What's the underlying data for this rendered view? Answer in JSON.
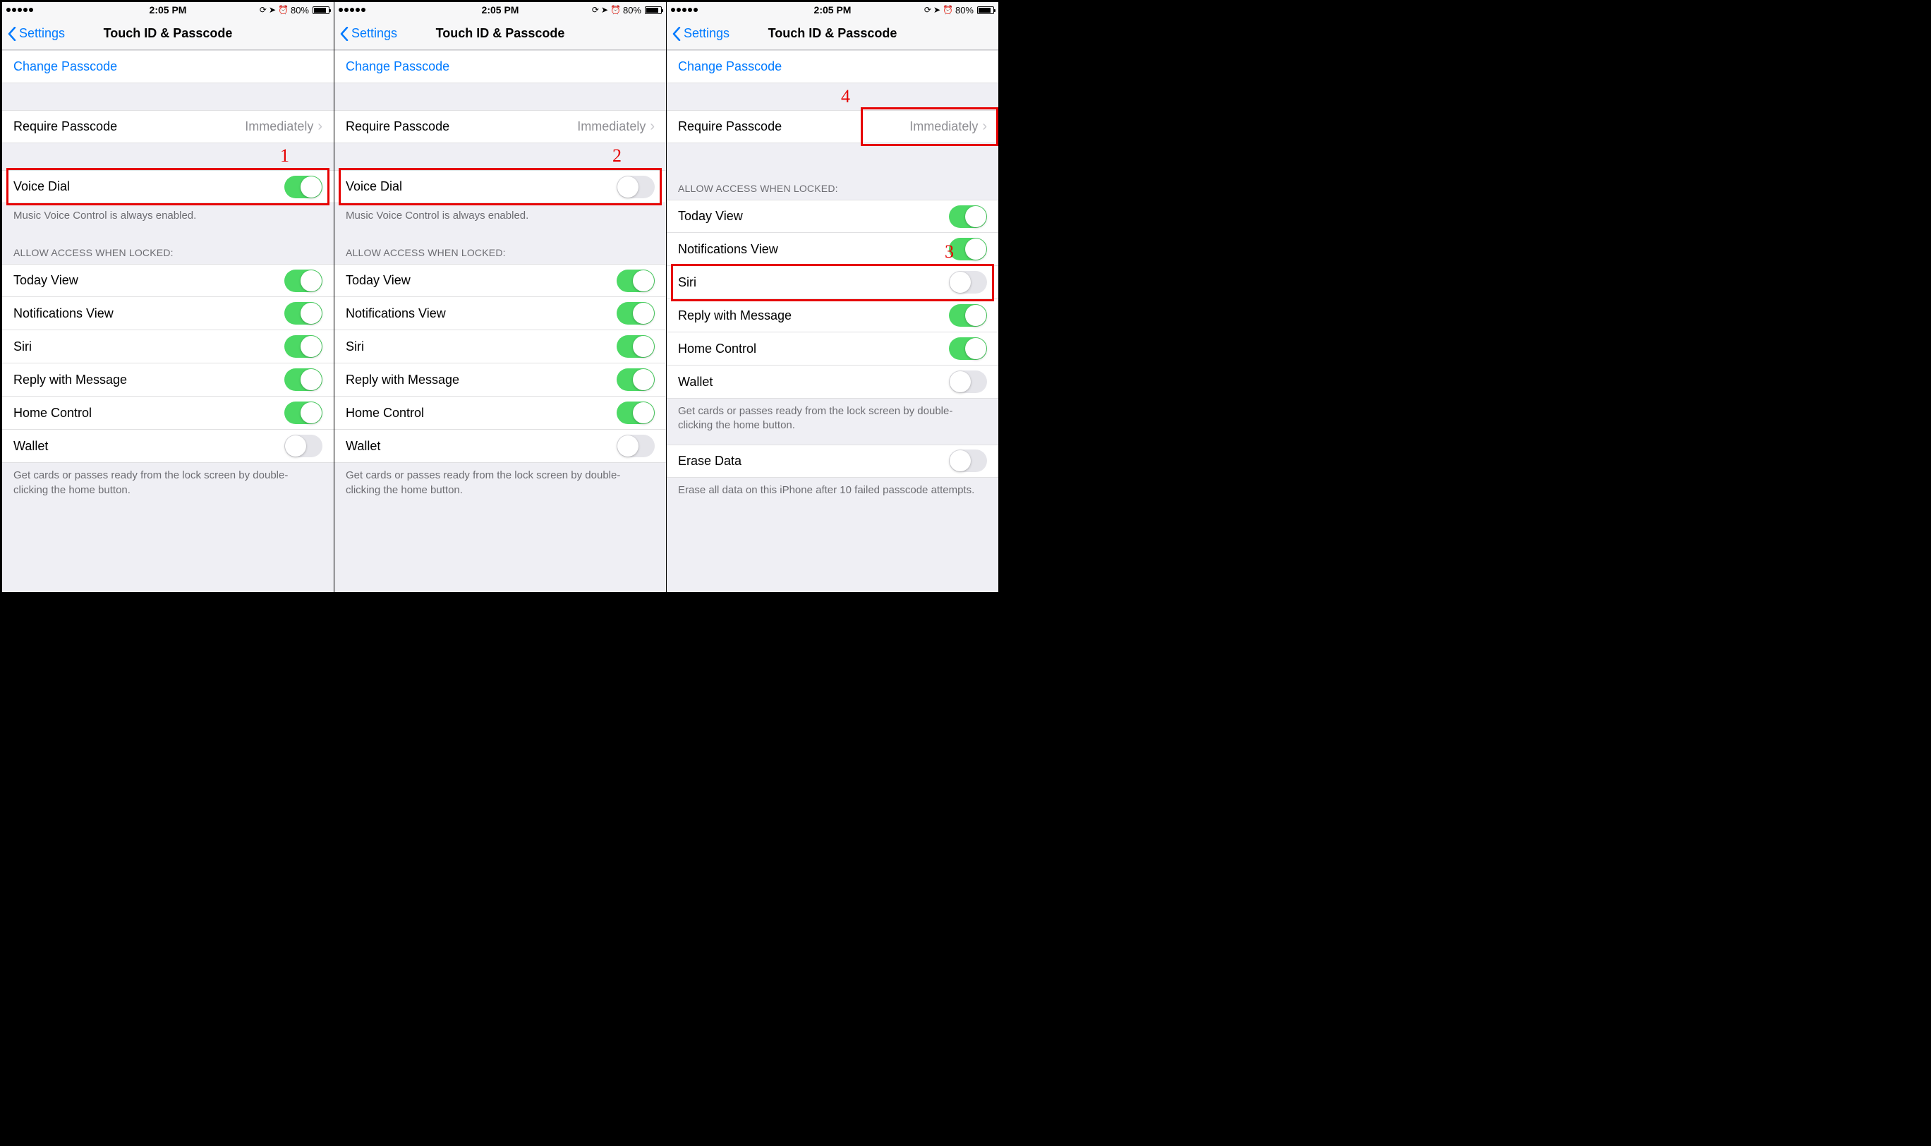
{
  "statusBar": {
    "time": "2:05 PM",
    "batteryPercent": "80%",
    "signalDots": 5
  },
  "nav": {
    "back": "Settings",
    "title": "Touch ID & Passcode"
  },
  "changePasscode": "Change Passcode",
  "requirePasscode": {
    "label": "Require Passcode",
    "value": "Immediately"
  },
  "voiceDial": {
    "label": "Voice Dial",
    "footer": "Music Voice Control is always enabled."
  },
  "allowHeader": "ALLOW ACCESS WHEN LOCKED:",
  "rows": {
    "today": "Today View",
    "notifications": "Notifications View",
    "siri": "Siri",
    "reply": "Reply with Message",
    "home": "Home Control",
    "wallet": "Wallet"
  },
  "walletFooter": "Get cards or passes ready from the lock screen by double-clicking the home button.",
  "eraseData": {
    "label": "Erase Data",
    "footer": "Erase all data on this iPhone after 10 failed passcode attempts."
  },
  "screens": [
    {
      "voiceDialOn": true,
      "showVoiceDial": true,
      "access": {
        "today": true,
        "notifications": true,
        "siri": true,
        "reply": true,
        "home": true,
        "wallet": false
      },
      "showErase": false,
      "highlight": {
        "target": "voiceDial",
        "label": "1",
        "labelPos": "topRight"
      }
    },
    {
      "voiceDialOn": false,
      "showVoiceDial": true,
      "access": {
        "today": true,
        "notifications": true,
        "siri": true,
        "reply": true,
        "home": true,
        "wallet": false
      },
      "showErase": false,
      "highlight": {
        "target": "voiceDial",
        "label": "2",
        "labelPos": "topRight"
      }
    },
    {
      "voiceDialOn": false,
      "showVoiceDial": false,
      "access": {
        "today": true,
        "notifications": true,
        "siri": false,
        "reply": true,
        "home": true,
        "wallet": false
      },
      "showErase": true,
      "eraseOn": false,
      "highlight": {
        "target": "siri",
        "label": "3",
        "labelPos": "topRight"
      },
      "highlight2": {
        "target": "requireValue",
        "label": "4",
        "labelPos": "topLeft"
      }
    }
  ]
}
